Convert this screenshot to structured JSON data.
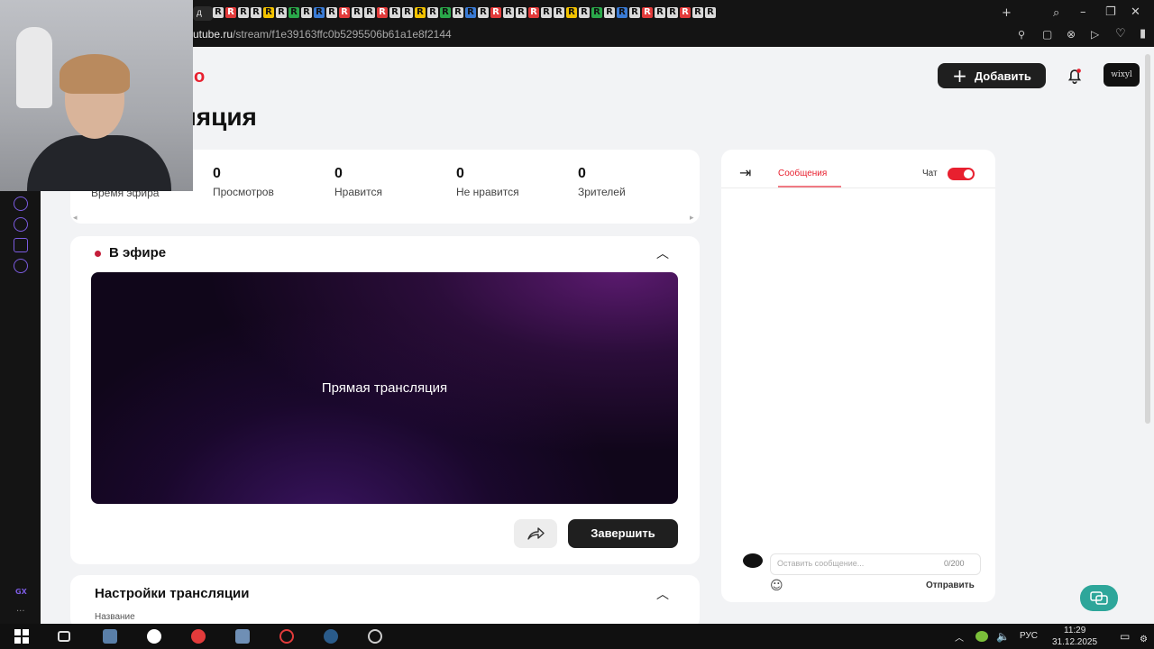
{
  "browser": {
    "url_domain": "utube.ru",
    "url_path": "/stream/f1e39163ffc0b5295506b61a1e8f2144",
    "tab_fragment": "д",
    "tab_letters": [
      "R",
      "R",
      "R",
      "R",
      "R",
      "R",
      "R",
      "R",
      "R",
      "R",
      "R",
      "R",
      "R",
      "R",
      "R",
      "R",
      "R",
      "R",
      "R",
      "R",
      "R",
      "R",
      "R",
      "R",
      "R",
      "R",
      "R",
      "R",
      "R",
      "R",
      "R",
      "R",
      "R",
      "R",
      "R",
      "R",
      "R",
      "R",
      "R",
      "R"
    ]
  },
  "header": {
    "logo_fragment": "о",
    "page_title": "ляция",
    "add_label": "Добавить",
    "avatar_text": "wixyl"
  },
  "stats": [
    {
      "value": "",
      "label": "Время эфира"
    },
    {
      "value": "0",
      "label": "Просмотров"
    },
    {
      "value": "0",
      "label": "Нравится"
    },
    {
      "value": "0",
      "label": "Не нравится"
    },
    {
      "value": "0",
      "label": "Зрителей"
    }
  ],
  "live": {
    "title": "В эфире",
    "player_text": "Прямая трансляция",
    "finish_label": "Завершить"
  },
  "settings": {
    "title": "Настройки трансляции",
    "field_label": "Название"
  },
  "chat": {
    "tab_messages": "Сообщения",
    "chat_label": "Чат",
    "chat_enabled": true,
    "input_placeholder": "Оставить сообщение...",
    "char_counter": "0/200",
    "send_label": "Отправить"
  },
  "taskbar": {
    "language": "РУС",
    "time": "11:29",
    "date": "31.12.2025"
  },
  "colors": {
    "accent": "#e8202f",
    "dark_button": "#1f1f1f",
    "help_button": "#2ea69a",
    "sidebar_icon": "#7b5be0"
  }
}
